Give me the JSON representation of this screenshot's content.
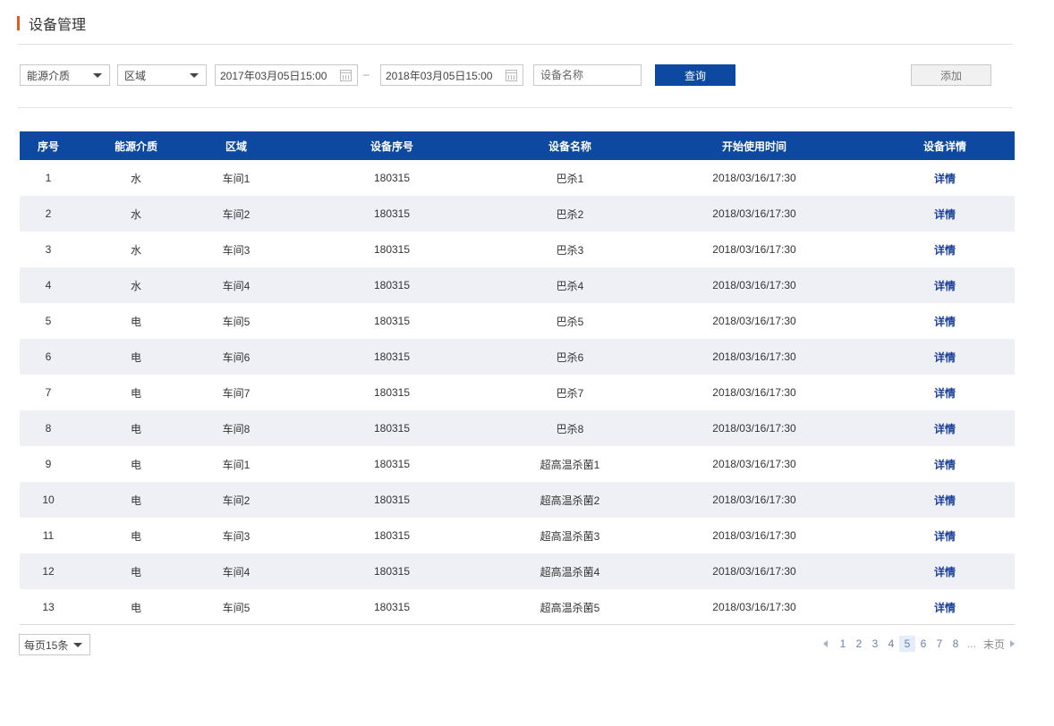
{
  "header": {
    "title": "设备管理"
  },
  "filters": {
    "energy_select": "能源介质",
    "area_select": "区域",
    "start_date": "2017年03月05日15:00",
    "end_date": "2018年03月05日15:00",
    "range_separator": "–",
    "name_placeholder": "设备名称",
    "query_label": "查询",
    "add_label": "添加"
  },
  "table": {
    "headers": [
      "序号",
      "能源介质",
      "区域",
      "设备序号",
      "设备名称",
      "开始使用时间",
      "设备详情"
    ],
    "rows": [
      [
        "1",
        "水",
        "车间1",
        "180315",
        "巴杀1",
        "2018/03/16/17:30",
        "详情"
      ],
      [
        "2",
        "水",
        "车间2",
        "180315",
        "巴杀2",
        "2018/03/16/17:30",
        "详情"
      ],
      [
        "3",
        "水",
        "车间3",
        "180315",
        "巴杀3",
        "2018/03/16/17:30",
        "详情"
      ],
      [
        "4",
        "水",
        "车间4",
        "180315",
        "巴杀4",
        "2018/03/16/17:30",
        "详情"
      ],
      [
        "5",
        "电",
        "车间5",
        "180315",
        "巴杀5",
        "2018/03/16/17:30",
        "详情"
      ],
      [
        "6",
        "电",
        "车间6",
        "180315",
        "巴杀6",
        "2018/03/16/17:30",
        "详情"
      ],
      [
        "7",
        "电",
        "车间7",
        "180315",
        "巴杀7",
        "2018/03/16/17:30",
        "详情"
      ],
      [
        "8",
        "电",
        "车间8",
        "180315",
        "巴杀8",
        "2018/03/16/17:30",
        "详情"
      ],
      [
        "9",
        "电",
        "车间1",
        "180315",
        "超高温杀菌1",
        "2018/03/16/17:30",
        "详情"
      ],
      [
        "10",
        "电",
        "车间2",
        "180315",
        "超高温杀菌2",
        "2018/03/16/17:30",
        "详情"
      ],
      [
        "11",
        "电",
        "车间3",
        "180315",
        "超高温杀菌3",
        "2018/03/16/17:30",
        "详情"
      ],
      [
        "12",
        "电",
        "车间4",
        "180315",
        "超高温杀菌4",
        "2018/03/16/17:30",
        "详情"
      ],
      [
        "13",
        "电",
        "车间5",
        "180315",
        "超高温杀菌5",
        "2018/03/16/17:30",
        "详情"
      ]
    ]
  },
  "pagination": {
    "page_size_label": "每页15条",
    "pages": [
      "1",
      "2",
      "3",
      "4",
      "5",
      "6",
      "7",
      "8"
    ],
    "current_page": "5",
    "ellipsis": "...",
    "last_label": "末页"
  },
  "colors": {
    "primary": "#0d49a0",
    "accent": "#e25b1e",
    "row_alt": "#eff0f5",
    "link": "#1a3e9a"
  }
}
